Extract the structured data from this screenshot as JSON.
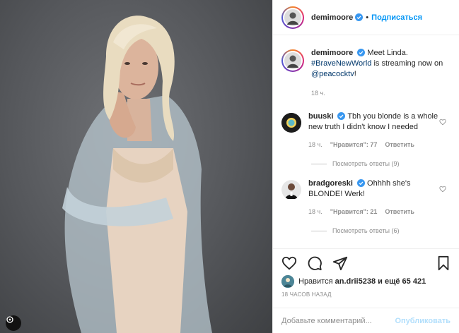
{
  "post": {
    "username": "demimoore",
    "separator": "•",
    "follow_label": "Подписаться",
    "caption": {
      "username": "demimoore",
      "text_before": "Meet Linda.",
      "hashtag": "#BraveNewWorld",
      "text_middle": "is streaming now on",
      "mention": "@peacocktv",
      "text_after": "!",
      "time": "18 ч."
    }
  },
  "comments": [
    {
      "username": "buuski",
      "text": "Tbh you blonde is a whole new truth I didn't know I needed",
      "time": "18 ч.",
      "likes": "\"Нравится\": 77",
      "reply_label": "Ответить",
      "view_replies": "Посмотреть ответы (9)"
    },
    {
      "username": "bradgoreski",
      "text": "Ohhhh she's BLONDE! Werk!",
      "time": "18 ч.",
      "likes": "\"Нравится\": 21",
      "reply_label": "Ответить",
      "view_replies": "Посмотреть ответы (6)"
    }
  ],
  "likes_bar": {
    "prefix": "Нравится",
    "user": "an.drii5238",
    "suffix": "и ещё 65 421"
  },
  "timestamp": "18 ЧАСОВ НАЗАД",
  "add_comment": {
    "placeholder": "Добавьте комментарий...",
    "publish_label": "Опубликовать"
  },
  "icons": {
    "like": "heart-icon",
    "comment": "comment-icon",
    "share": "paper-plane-icon",
    "save": "bookmark-icon",
    "verified": "verified-badge-icon",
    "carousel": "carousel-indicator-icon"
  },
  "colors": {
    "accent": "#0095f6",
    "verified": "#3897f0",
    "muted": "#8e8e8e",
    "publish_disabled": "#b2dffc"
  }
}
